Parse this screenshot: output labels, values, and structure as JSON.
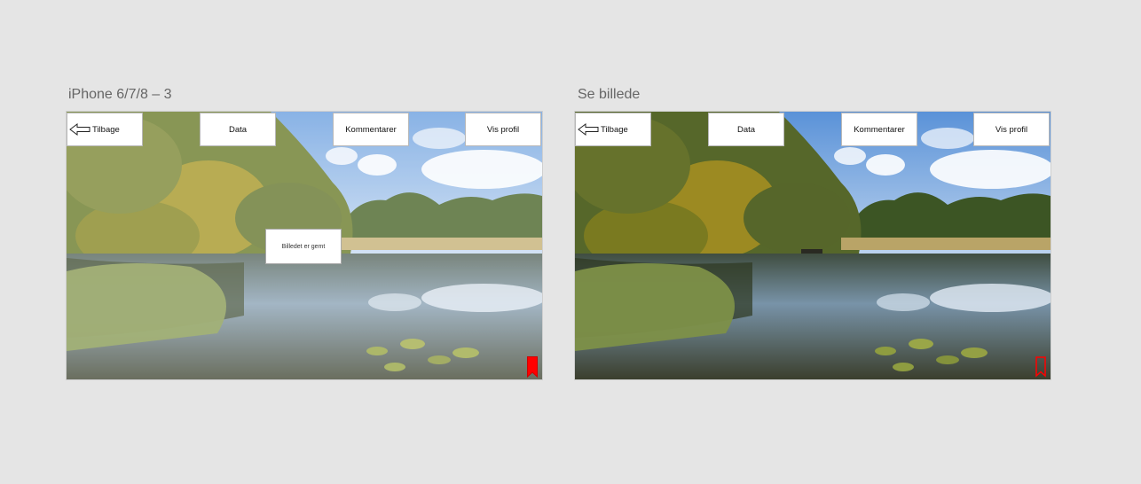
{
  "colors": {
    "background": "#e5e5e5",
    "bookmark_red": "#ff0000",
    "button_bg": "#ffffff",
    "button_border": "#b8b8b8"
  },
  "artboards": [
    {
      "title": "iPhone 6/7/8 – 3",
      "nav": {
        "back": "Tilbage",
        "data": "Data",
        "comments": "Kommentarer",
        "profile": "Vis profil"
      },
      "toast": "Billedet er gemt",
      "bookmark_icon": "bookmark-filled-icon"
    },
    {
      "title": "Se billede",
      "nav": {
        "back": "Tilbage",
        "data": "Data",
        "comments": "Kommentarer",
        "profile": "Vis profil"
      },
      "bookmark_icon": "bookmark-outline-icon"
    }
  ]
}
